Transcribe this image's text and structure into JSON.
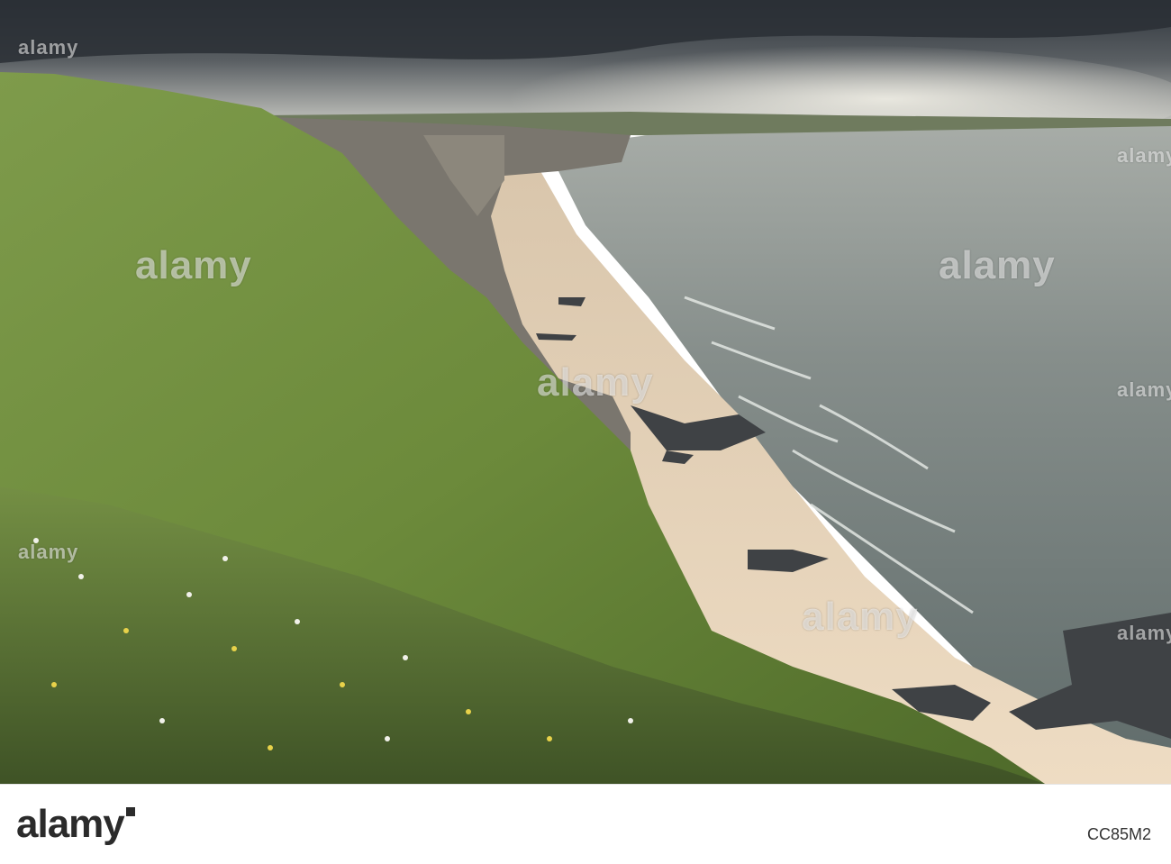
{
  "watermark": {
    "text": "alamy"
  },
  "footer": {
    "brand": "alamy",
    "image_id": "CC85M2"
  },
  "colors": {
    "sky_dark": "#3a4047",
    "sky_light": "#c9cbc6",
    "sea": "#7f8a88",
    "sand": "#e8d3b8",
    "grass": "#6f8a3f",
    "cliff_rock": "#6d6a63"
  }
}
